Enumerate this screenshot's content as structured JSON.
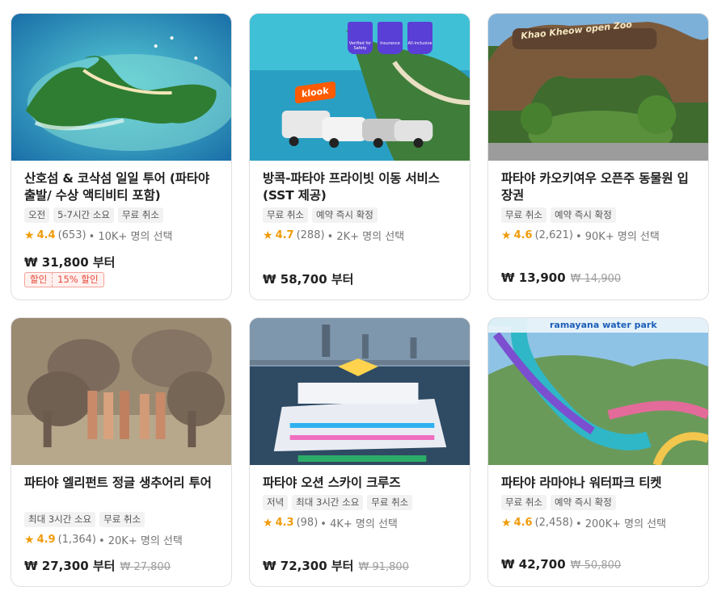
{
  "cards": [
    {
      "title": "산호섬 & 코삭섬 일일 투어 (파타야 출발/ 수상 액티비티 포함)",
      "tags": [
        "오전",
        "5-7시간 소요",
        "무료 취소"
      ],
      "score": "4.4",
      "reviews": "(653)",
      "booked": "• 10K+ 명의 선택",
      "price": "₩ 31,800 부터",
      "old_price": "",
      "promo_label": "할인",
      "promo_value": "15% 할인"
    },
    {
      "title": "방콕-파타야 프라이빗 이동 서비스 (SST 제공)",
      "tags": [
        "무료 취소",
        "예약 즉시 확정"
      ],
      "score": "4.7",
      "reviews": "(288)",
      "booked": "• 2K+ 명의 선택",
      "price": "₩ 58,700 부터",
      "old_price": "",
      "badges": [
        "Verified for Safety",
        "Insurance",
        "All-inclusive"
      ],
      "brand": "klook"
    },
    {
      "title": "파타야 카오키여우 오픈주 동물원 입장권",
      "tags": [
        "무료 취소",
        "예약 즉시 확정"
      ],
      "score": "4.6",
      "reviews": "(2,621)",
      "booked": "• 90K+ 명의 선택",
      "price": "₩ 13,900",
      "old_price": "₩ 14,900",
      "sign": "Khao Kheow open Zoo"
    },
    {
      "title": "파타야 엘리펀트 정글 생추어리 투어",
      "tags": [
        "최대 3시간 소요",
        "무료 취소"
      ],
      "score": "4.9",
      "reviews": "(1,364)",
      "booked": "• 20K+ 명의 선택",
      "price": "₩ 27,300 부터",
      "old_price": "₩ 27,800"
    },
    {
      "title": "파타야 오션 스카이 크루즈",
      "tags": [
        "저녁",
        "최대 3시간 소요",
        "무료 취소"
      ],
      "score": "4.3",
      "reviews": "(98)",
      "booked": "• 4K+ 명의 선택",
      "price": "₩ 72,300 부터",
      "old_price": "₩ 91,800"
    },
    {
      "title": "파타야 라마야나 워터파크 티켓",
      "tags": [
        "무료 취소",
        "예약 즉시 확정"
      ],
      "score": "4.6",
      "reviews": "(2,458)",
      "booked": "• 200K+ 명의 선택",
      "price": "₩ 42,700",
      "old_price": "₩ 50,800",
      "logo": "ramayana water park"
    }
  ],
  "colors": {
    "accent_star": "#f09b0a",
    "promo": "#e64a3b",
    "border": "#e0e0e0"
  }
}
